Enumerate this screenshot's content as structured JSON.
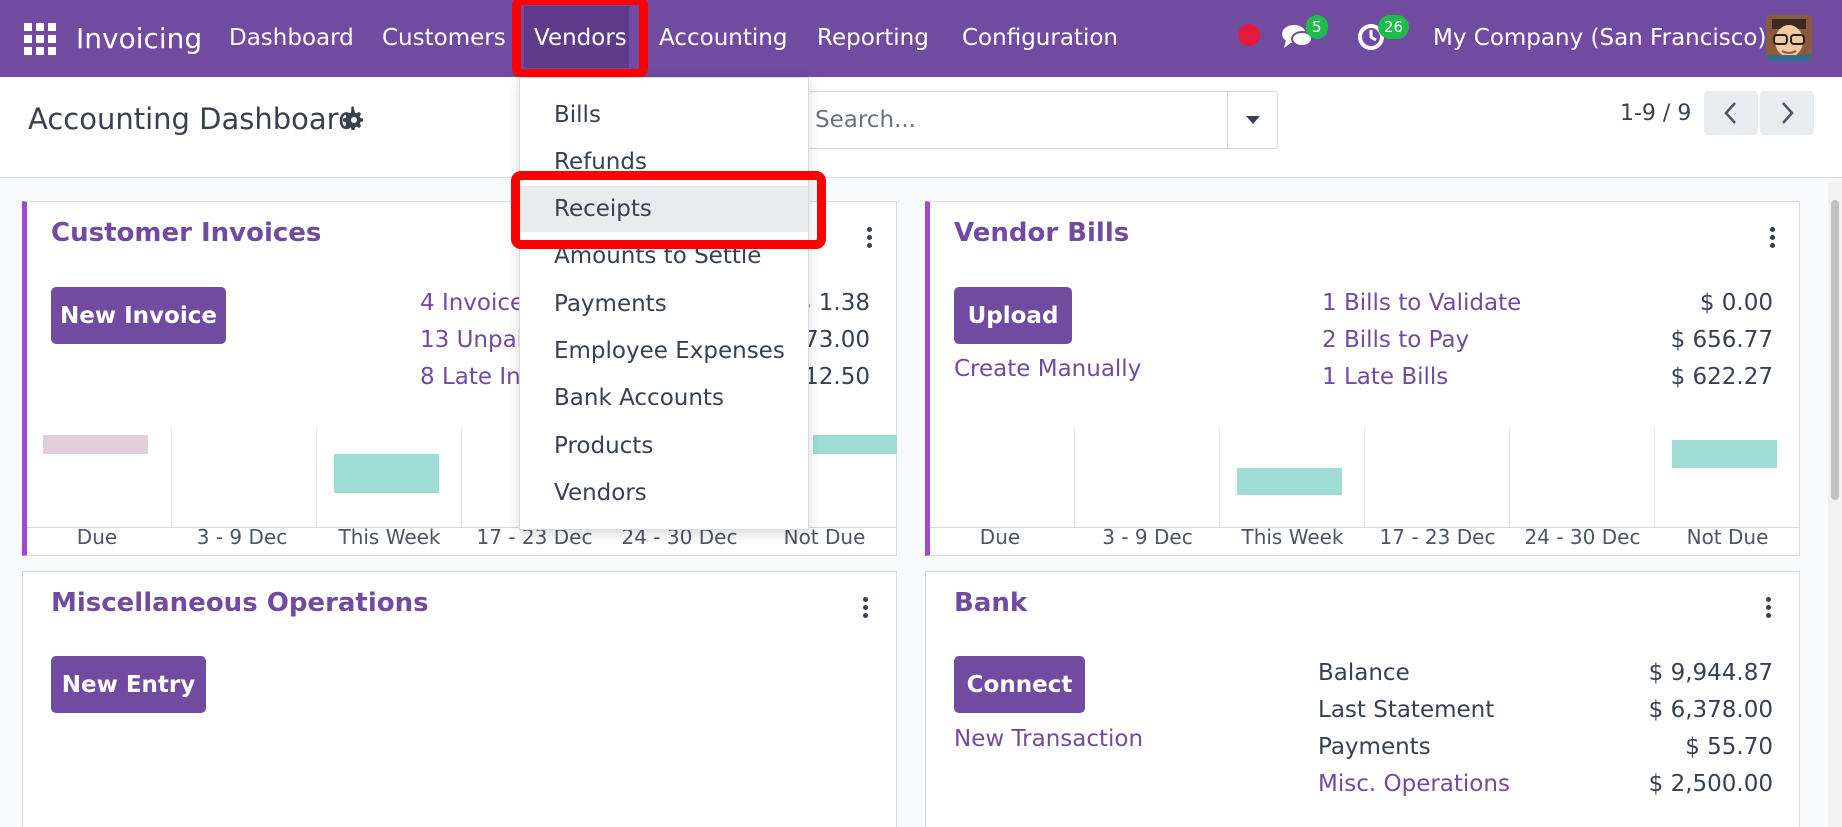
{
  "navbar": {
    "brand": "Invoicing",
    "menu": [
      "Dashboard",
      "Customers",
      "Vendors",
      "Accounting",
      "Reporting",
      "Configuration"
    ],
    "active": "Vendors",
    "messages_count": "5",
    "activities_count": "26",
    "company": "My Company (San Francisco)",
    "colors": {
      "bar": "#714b9f",
      "active": "#5e3c8b",
      "badge": "#1ebc4f",
      "rec": "#e21b3c",
      "highlight": "#ff0000"
    }
  },
  "control_panel": {
    "title": "Accounting Dashboard",
    "search_placeholder": "Search...",
    "pager": "1-9 / 9"
  },
  "vendors_menu": {
    "items": [
      "Bills",
      "Refunds",
      "Receipts",
      "Amounts to Settle",
      "Payments",
      "Employee Expenses",
      "Bank Accounts",
      "Products",
      "Vendors"
    ],
    "hovered": "Receipts"
  },
  "cards": {
    "customer_invoices": {
      "title": "Customer Invoices",
      "button": "New Invoice",
      "stats": [
        {
          "label": "4 Invoices",
          "value": "$ 1.38"
        },
        {
          "label": "13 Unpaid",
          "value": "73.00"
        },
        {
          "label": "8 Late Inv",
          "value": "12.50"
        }
      ],
      "chart_ticks": [
        "Due",
        "3 - 9 Dec",
        "This Week",
        "17 - 23 Dec",
        "24 - 30 Dec",
        "Not Due"
      ]
    },
    "vendor_bills": {
      "title": "Vendor Bills",
      "button": "Upload",
      "link": "Create Manually",
      "stats": [
        {
          "label": "1 Bills to Validate",
          "value": "$ 0.00"
        },
        {
          "label": "2 Bills to Pay",
          "value": "$ 656.77"
        },
        {
          "label": "1 Late Bills",
          "value": "$ 622.27"
        }
      ],
      "chart_ticks": [
        "Due",
        "3 - 9 Dec",
        "This Week",
        "17 - 23 Dec",
        "24 - 30 Dec",
        "Not Due"
      ]
    },
    "misc": {
      "title": "Miscellaneous Operations",
      "button": "New Entry"
    },
    "bank": {
      "title": "Bank",
      "button": "Connect",
      "link": "New Transaction",
      "stats": [
        {
          "label": "Balance",
          "value": "$ 9,944.87"
        },
        {
          "label": "Last Statement",
          "value": "$ 6,378.00"
        },
        {
          "label": "Payments",
          "value": "$ 55.70"
        },
        {
          "label": "Misc. Operations",
          "value": "$ 2,500.00"
        }
      ]
    }
  }
}
